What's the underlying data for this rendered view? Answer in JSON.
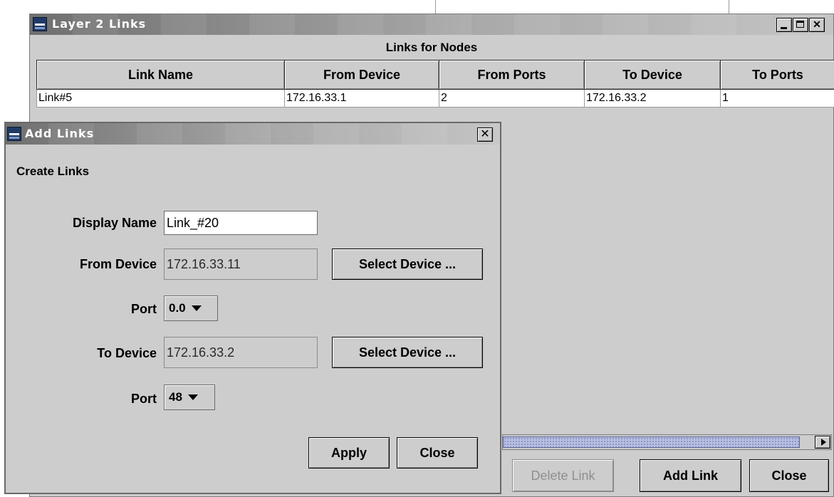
{
  "main_window": {
    "title": "Layer 2 Links",
    "caption": "Links for Nodes",
    "columns": [
      "Link Name",
      "From Device",
      "From Ports",
      "To Device",
      "To Ports"
    ],
    "rows": [
      [
        "Link#5",
        "172.16.33.1",
        "2",
        "172.16.33.2",
        "1"
      ]
    ],
    "buttons": {
      "delete_link": "Delete Link",
      "add_link": "Add Link",
      "close": "Close"
    }
  },
  "add_links_dialog": {
    "title": "Add Links",
    "section_title": "Create Links",
    "display_name_label": "Display Name",
    "display_name_value": "Link_#20",
    "from_device_label": "From Device",
    "from_device_value": "172.16.33.11",
    "from_port_label": "Port",
    "from_port_value": "0.0",
    "to_device_label": "To Device",
    "to_device_value": "172.16.33.2",
    "to_port_label": "Port",
    "to_port_value": "48",
    "select_device_label": "Select Device ...",
    "apply_label": "Apply",
    "close_label": "Close"
  },
  "colors": {
    "window_bg": "#cdcdcd",
    "titlebar_dark": "#6f6f6f",
    "scroll_thumb": "#b8bfe2"
  }
}
